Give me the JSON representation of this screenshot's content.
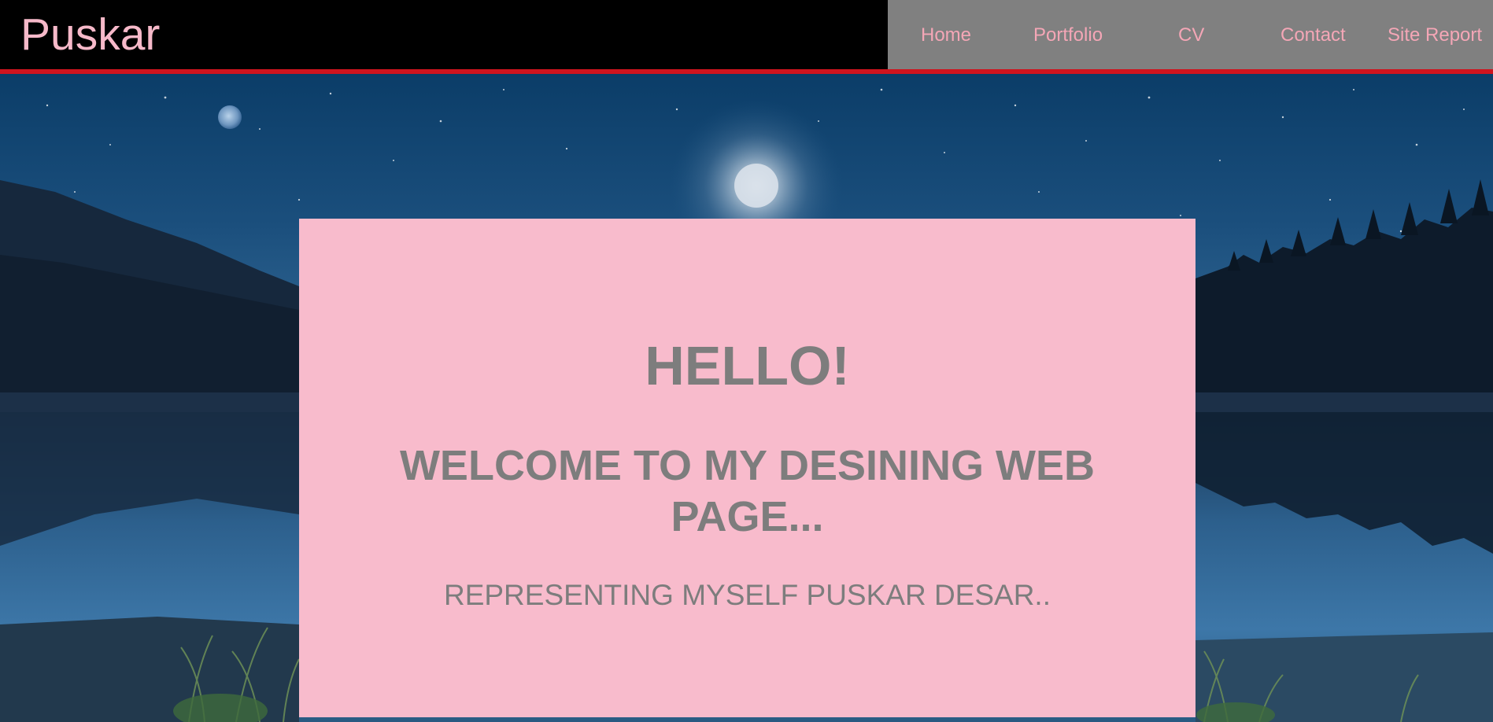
{
  "header": {
    "brand": "Puskar",
    "nav": [
      {
        "label": "Home"
      },
      {
        "label": "Portfolio"
      },
      {
        "label": "CV"
      },
      {
        "label": "Contact"
      },
      {
        "label": "Site Report"
      }
    ]
  },
  "hero": {
    "background_scene": "night-lake-mountains-moon",
    "title": "HELLO!",
    "subtitle_line1": "WELCOME TO MY DESINING WEB",
    "subtitle_line2": "PAGE...",
    "tagline": "REPRESENTING MYSELF PUSKAR DESAR.."
  },
  "colors": {
    "header_bg": "#000000",
    "header_accent": "#d0141e",
    "nav_bg": "#808080",
    "nav_text": "#f4a6b6",
    "brand_text": "#f6b9c9",
    "card_bg": "#f8bbcc",
    "card_text": "#7d7d7d"
  }
}
